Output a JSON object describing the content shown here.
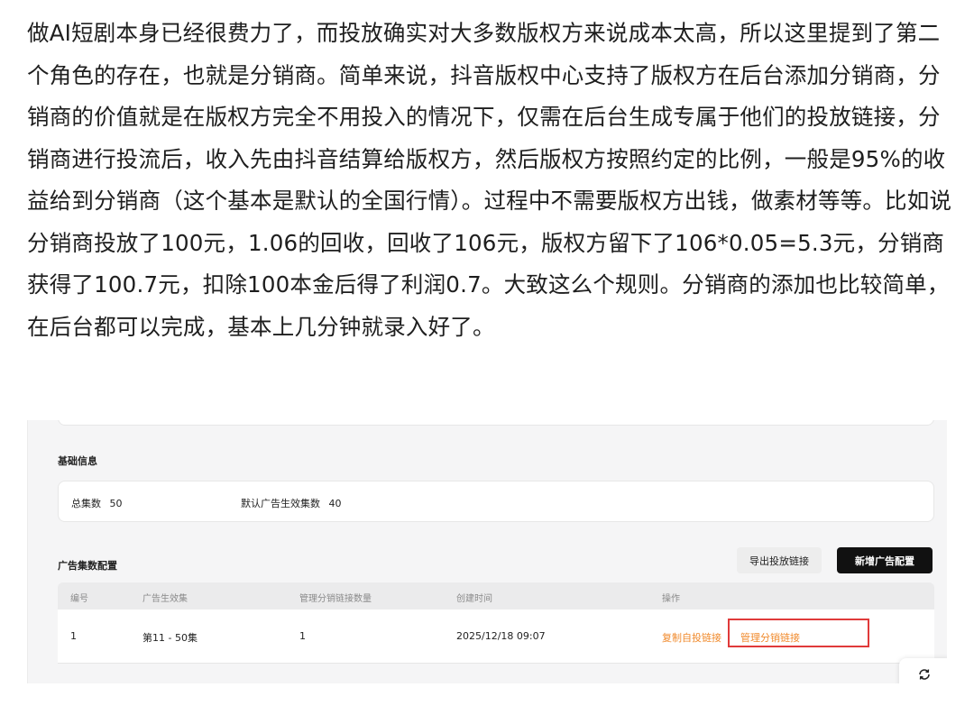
{
  "article": {
    "paragraph": "做AI短剧本身已经很费力了，而投放确实对大多数版权方来说成本太高，所以这里提到了第二个角色的存在，也就是分销商。简单来说，抖音版权中心支持了版权方在后台添加分销商，分销商的价值就是在版权方完全不用投入的情况下，仅需在后台生成专属于他们的投放链接，分销商进行投流后，收入先由抖音结算给版权方，然后版权方按照约定的比例，一般是95%的收益给到分销商（这个基本是默认的全国行情）。过程中不需要版权方出钱，做素材等等。比如说分销商投放了100元，1.06的回收，回收了106元，版权方留下了106*0.05=5.3元，分销商获得了100.7元，扣除100本金后得了利润0.7。大致这么个规则。分销商的添加也比较简单，在后台都可以完成，基本上几分钟就录入好了。"
  },
  "screenshot": {
    "basic_info": {
      "title": "基础信息",
      "total_episodes_label": "总集数",
      "total_episodes_value": "50",
      "default_ad_episodes_label": "默认广告生效集数",
      "default_ad_episodes_value": "40"
    },
    "ad_config": {
      "title": "广告集数配置",
      "export_button": "导出投放链接",
      "add_button": "新增广告配置",
      "columns": [
        "编号",
        "广告生效集",
        "管理分销链接数量",
        "创建时间",
        "操作"
      ],
      "rows": [
        {
          "id": "1",
          "episodes": "第11 - 50集",
          "link_count": "1",
          "created_at": "2025/12/18 09:07",
          "action_copy": "复制自投链接",
          "action_manage": "管理分销链接"
        }
      ]
    },
    "colors": {
      "accent_orange": "#f08a2c",
      "highlight_red": "#e03a3a",
      "primary_button": "#111111"
    },
    "float_icon": "refresh-icon"
  }
}
